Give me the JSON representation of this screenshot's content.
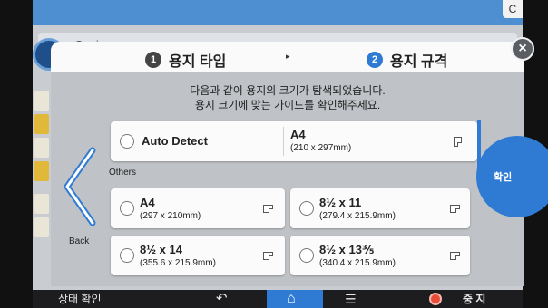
{
  "background": {
    "header_text": "Copier",
    "top_right_glyph": "C"
  },
  "modal": {
    "steps": [
      {
        "number": "1",
        "label": "용지 타입"
      },
      {
        "number": "2",
        "label": "용지 규격"
      }
    ],
    "step_arrow": "▸",
    "close_glyph": "×",
    "message_line1": "다음과 같이 용지의 크기가 탐색되었습니다.",
    "message_line2": "용지 크기에 맞는 가이드를 확인해주세요.",
    "auto_detect": {
      "label": "Auto Detect",
      "detected_size": "A4",
      "detected_dims": "(210 x 297mm)"
    },
    "others_label": "Others",
    "options": [
      {
        "name": "A4",
        "dims": "(297 x 210mm)"
      },
      {
        "name": "8½ x 11",
        "dims": "(279.4 x 215.9mm)"
      },
      {
        "name": "8½ x 14",
        "dims": "(355.6 x 215.9mm)"
      },
      {
        "name": "8½ x 13⅗",
        "dims": "(340.4 x 215.9mm)"
      }
    ],
    "back_label": "Back",
    "confirm_label": "확인"
  },
  "bottom_bar": {
    "status_label": "상태 확인",
    "back_glyph": "↶",
    "home_glyph": "⌂",
    "menu_glyph": "☰",
    "stop_label": "중 지"
  },
  "colors": {
    "accent": "#2f7bd3",
    "stop": "#e84d3a"
  }
}
